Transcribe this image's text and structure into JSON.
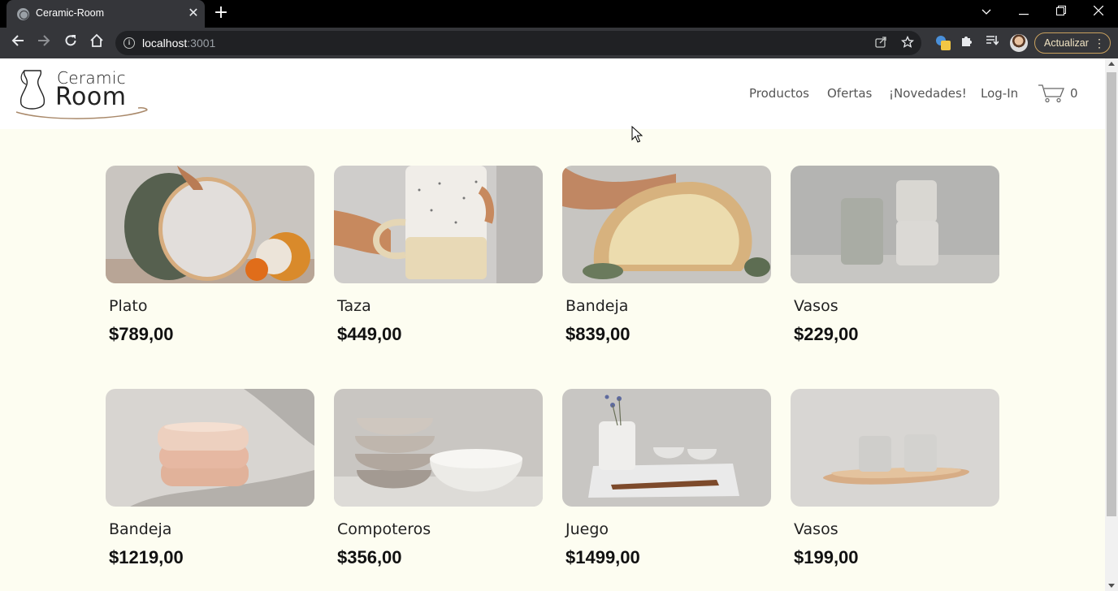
{
  "browser": {
    "tab_title": "Ceramic-Room",
    "url_host": "localhost",
    "url_port": ":3001",
    "update_label": "Actualizar"
  },
  "site": {
    "logo_line1": "Ceramic",
    "logo_line2": "Room",
    "nav": [
      {
        "label": "Productos"
      },
      {
        "label": "Ofertas"
      },
      {
        "label": "¡Novedades!"
      },
      {
        "label": "Log-In"
      }
    ],
    "cart_count": "0"
  },
  "products": [
    {
      "name": "Plato",
      "price": "$789,00"
    },
    {
      "name": "Taza",
      "price": "$449,00"
    },
    {
      "name": "Bandeja",
      "price": "$839,00"
    },
    {
      "name": "Vasos",
      "price": "$229,00"
    },
    {
      "name": "Bandeja",
      "price": "$1219,00"
    },
    {
      "name": "Compoteros",
      "price": "$356,00"
    },
    {
      "name": "Juego",
      "price": "$1499,00"
    },
    {
      "name": "Vasos",
      "price": "$199,00"
    }
  ],
  "colors": {
    "page_bg": "#fdfdf1",
    "header_bg": "#ffffff",
    "logo_accent": "#a9896a",
    "chrome_dark": "#35363a"
  }
}
